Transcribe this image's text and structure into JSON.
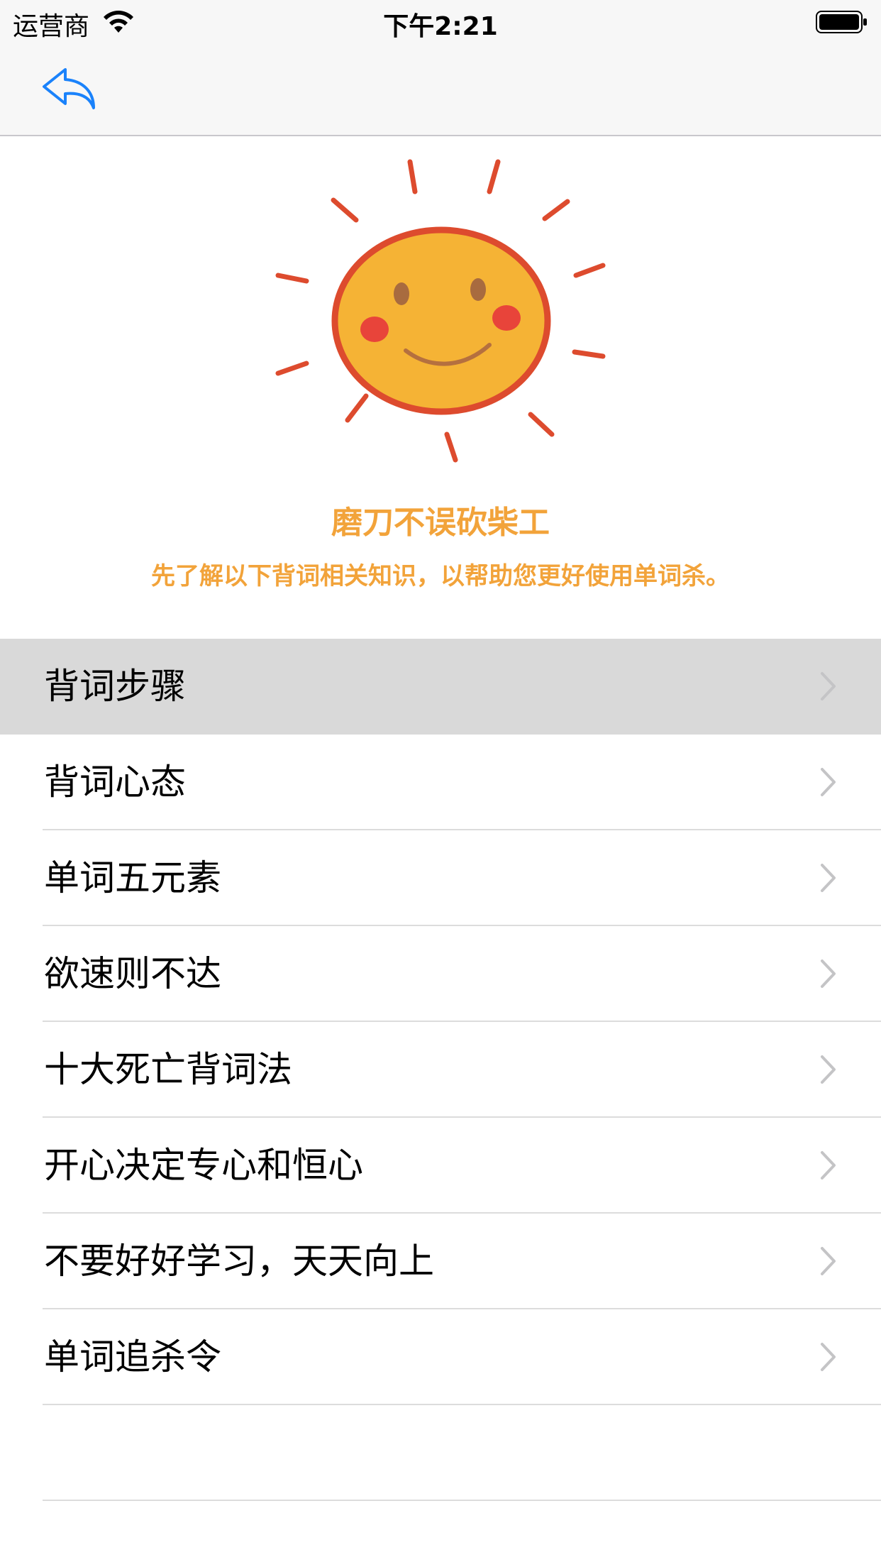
{
  "status_bar": {
    "carrier": "运营商",
    "time": "下午2:21"
  },
  "nav": {
    "back_icon": "back-arrow-icon",
    "accent_color": "#1a82fb"
  },
  "header": {
    "illustration": "smiling-sun-icon",
    "headline": "磨刀不误砍柴工",
    "subline": "先了解以下背词相关知识，以帮助您更好使用单词杀。",
    "accent_color": "#f2a33a"
  },
  "list": {
    "items": [
      {
        "label": "背词步骤",
        "selected": true
      },
      {
        "label": "背词心态",
        "selected": false
      },
      {
        "label": "单词五元素",
        "selected": false
      },
      {
        "label": "欲速则不达",
        "selected": false
      },
      {
        "label": "十大死亡背词法",
        "selected": false
      },
      {
        "label": "开心决定专心和恒心",
        "selected": false
      },
      {
        "label": "不要好好学习，天天向上",
        "selected": false
      },
      {
        "label": "单词追杀令",
        "selected": false
      }
    ],
    "chevron_icon": "chevron-right-icon"
  }
}
